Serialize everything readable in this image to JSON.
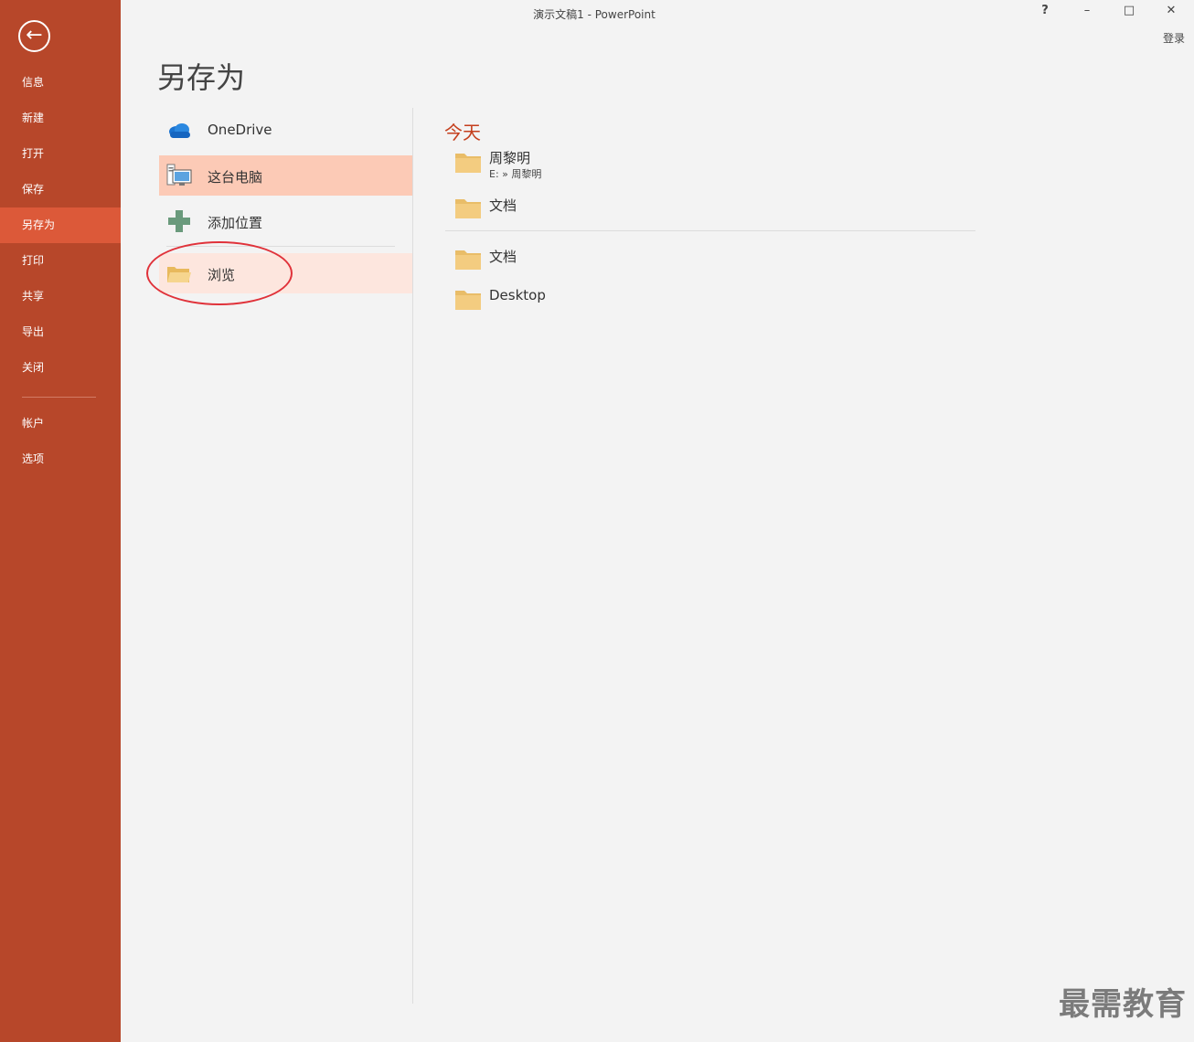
{
  "window": {
    "title": "演示文稿1 - PowerPoint",
    "help": "?",
    "minimize": "–",
    "maximize": "□",
    "close": "✕",
    "signin": "登录"
  },
  "sidebar": {
    "back_icon": "←",
    "items": [
      "信息",
      "新建",
      "打开",
      "保存",
      "另存为",
      "打印",
      "共享",
      "导出",
      "关闭"
    ],
    "active": "另存为",
    "bottom_items": [
      "帐户",
      "选项"
    ]
  },
  "page_title": "另存为",
  "places": {
    "onedrive": "OneDrive",
    "this_pc": "这台电脑",
    "add_place": "添加位置",
    "browse": "浏览"
  },
  "recent": {
    "today_heading": "今天",
    "folders_today": [
      {
        "name": "周黎明",
        "path": "E: » 周黎明"
      },
      {
        "name": "文档"
      }
    ],
    "folders_older": [
      {
        "name": "文档"
      },
      {
        "name": "Desktop"
      }
    ]
  },
  "colors": {
    "sidebar": "#b7472a",
    "active_nav": "#dc5939",
    "accent": "#c43e1c",
    "selected_place": "#fccab6",
    "folder": "#f0c77a"
  },
  "watermark": "最需教育"
}
